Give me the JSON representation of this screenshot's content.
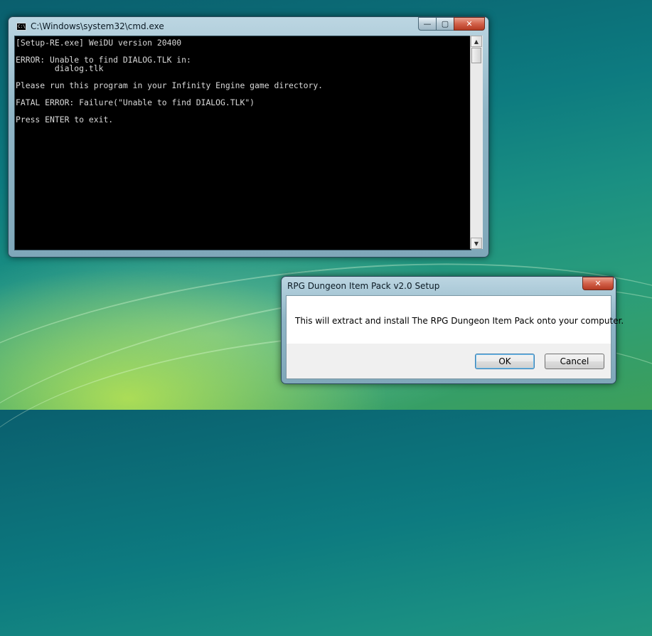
{
  "cmd_window": {
    "title": "C:\\Windows\\system32\\cmd.exe",
    "icon": "cmd-icon",
    "controls": {
      "minimize": "—",
      "maximize": "▢",
      "close": "✕"
    },
    "output": "[Setup-RE.exe] WeiDU version 20400\n\nERROR: Unable to find DIALOG.TLK in:\n        dialog.tlk\n\nPlease run this program in your Infinity Engine game directory.\n\nFATAL ERROR: Failure(\"Unable to find DIALOG.TLK\")\n\nPress ENTER to exit.",
    "scroll_up": "▲",
    "scroll_down": "▼"
  },
  "setup_dialog": {
    "title": "RPG Dungeon Item Pack v2.0 Setup",
    "close": "✕",
    "message": "This will extract and install The RPG Dungeon Item Pack onto your computer.",
    "ok_label": "OK",
    "cancel_label": "Cancel"
  },
  "colors": {
    "console_background": "#000000",
    "console_text": "#d9d9d9",
    "close_button": "#c8452c"
  }
}
